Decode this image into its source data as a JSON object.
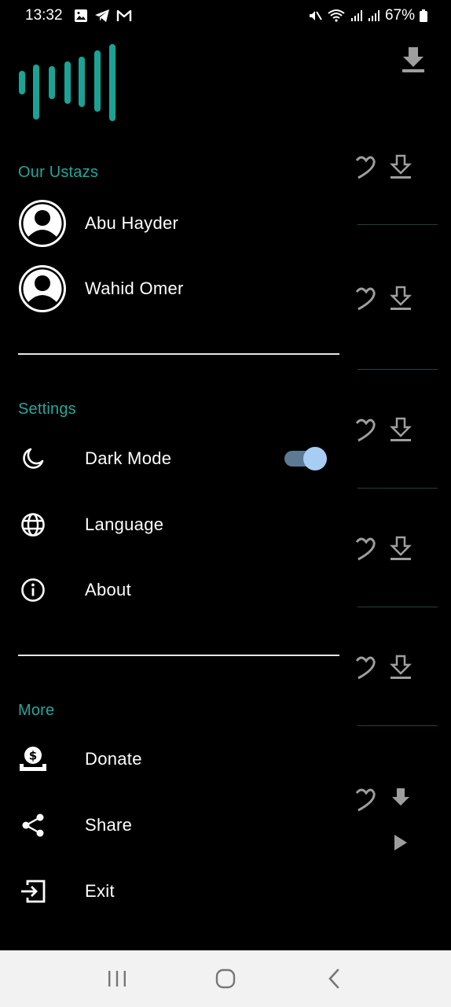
{
  "status": {
    "time": "13:32",
    "battery": "67%"
  },
  "sections": {
    "ustazs_title": "Our Ustazs",
    "settings_title": "Settings",
    "more_title": "More"
  },
  "ustazs": [
    {
      "name": "Abu Hayder"
    },
    {
      "name": "Wahid Omer"
    }
  ],
  "settings": {
    "dark_mode": {
      "label": "Dark Mode",
      "enabled": true
    },
    "language": {
      "label": "Language"
    },
    "about": {
      "label": "About"
    }
  },
  "more": {
    "donate": {
      "label": "Donate"
    },
    "share": {
      "label": "Share"
    },
    "exit": {
      "label": "Exit"
    }
  },
  "colors": {
    "accent": "#26a69a",
    "toggle_thumb": "#a8cdf2",
    "toggle_track": "#5c7a94",
    "background": "#000000"
  }
}
